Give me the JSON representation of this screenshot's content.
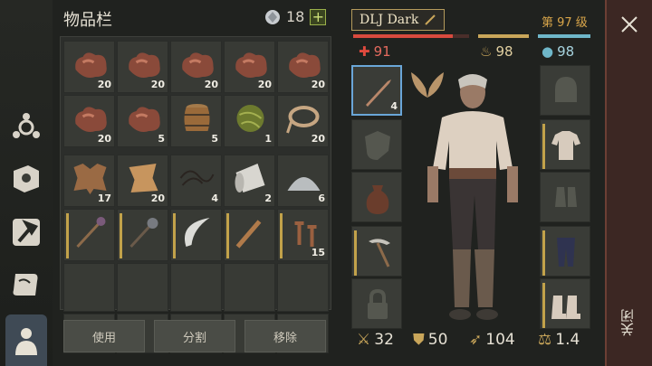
{
  "inventory": {
    "title": "物品栏",
    "currency_count": "18",
    "plus": "+",
    "items": [
      {
        "icon": "copper-ore-icon",
        "qty": "20"
      },
      {
        "icon": "copper-ore-icon",
        "qty": "20"
      },
      {
        "icon": "copper-ore-icon",
        "qty": "20"
      },
      {
        "icon": "copper-ore-icon",
        "qty": "20"
      },
      {
        "icon": "copper-ore-icon",
        "qty": "20"
      },
      {
        "icon": "copper-ore-icon",
        "qty": "20"
      },
      {
        "icon": "copper-ore-icon",
        "qty": "5"
      },
      {
        "icon": "barrel-icon",
        "qty": "5"
      },
      {
        "icon": "fiber-ball-icon",
        "qty": "1"
      },
      {
        "icon": "rope-icon",
        "qty": "20"
      },
      {
        "icon": "leather-hide-icon",
        "qty": "17"
      },
      {
        "icon": "parchment-icon",
        "qty": "20"
      },
      {
        "icon": "string-icon",
        "qty": "4"
      },
      {
        "icon": "cloth-roll-icon",
        "qty": "2"
      },
      {
        "icon": "powder-pile-icon",
        "qty": "6"
      },
      {
        "icon": "mace-icon",
        "qty": ""
      },
      {
        "icon": "spiked-mace-icon",
        "qty": ""
      },
      {
        "icon": "scimitar-icon",
        "qty": ""
      },
      {
        "icon": "club-icon",
        "qty": ""
      },
      {
        "icon": "hammers-icon",
        "qty": "15"
      }
    ],
    "buttons": {
      "use": "使用",
      "split": "分割",
      "remove": "移除"
    }
  },
  "character": {
    "name": "DLJ Dark",
    "level": "第 97 级",
    "health": "91",
    "hunger": "98",
    "water": "98",
    "weapon_qty": "4",
    "stats": {
      "attack": "32",
      "defense": "50",
      "speed": "104",
      "weight": "1.4"
    }
  },
  "close": {
    "label": "关闭"
  },
  "colors": {
    "health": "#d84a3e",
    "hunger": "#c9a65a",
    "water": "#6fb7c9"
  }
}
